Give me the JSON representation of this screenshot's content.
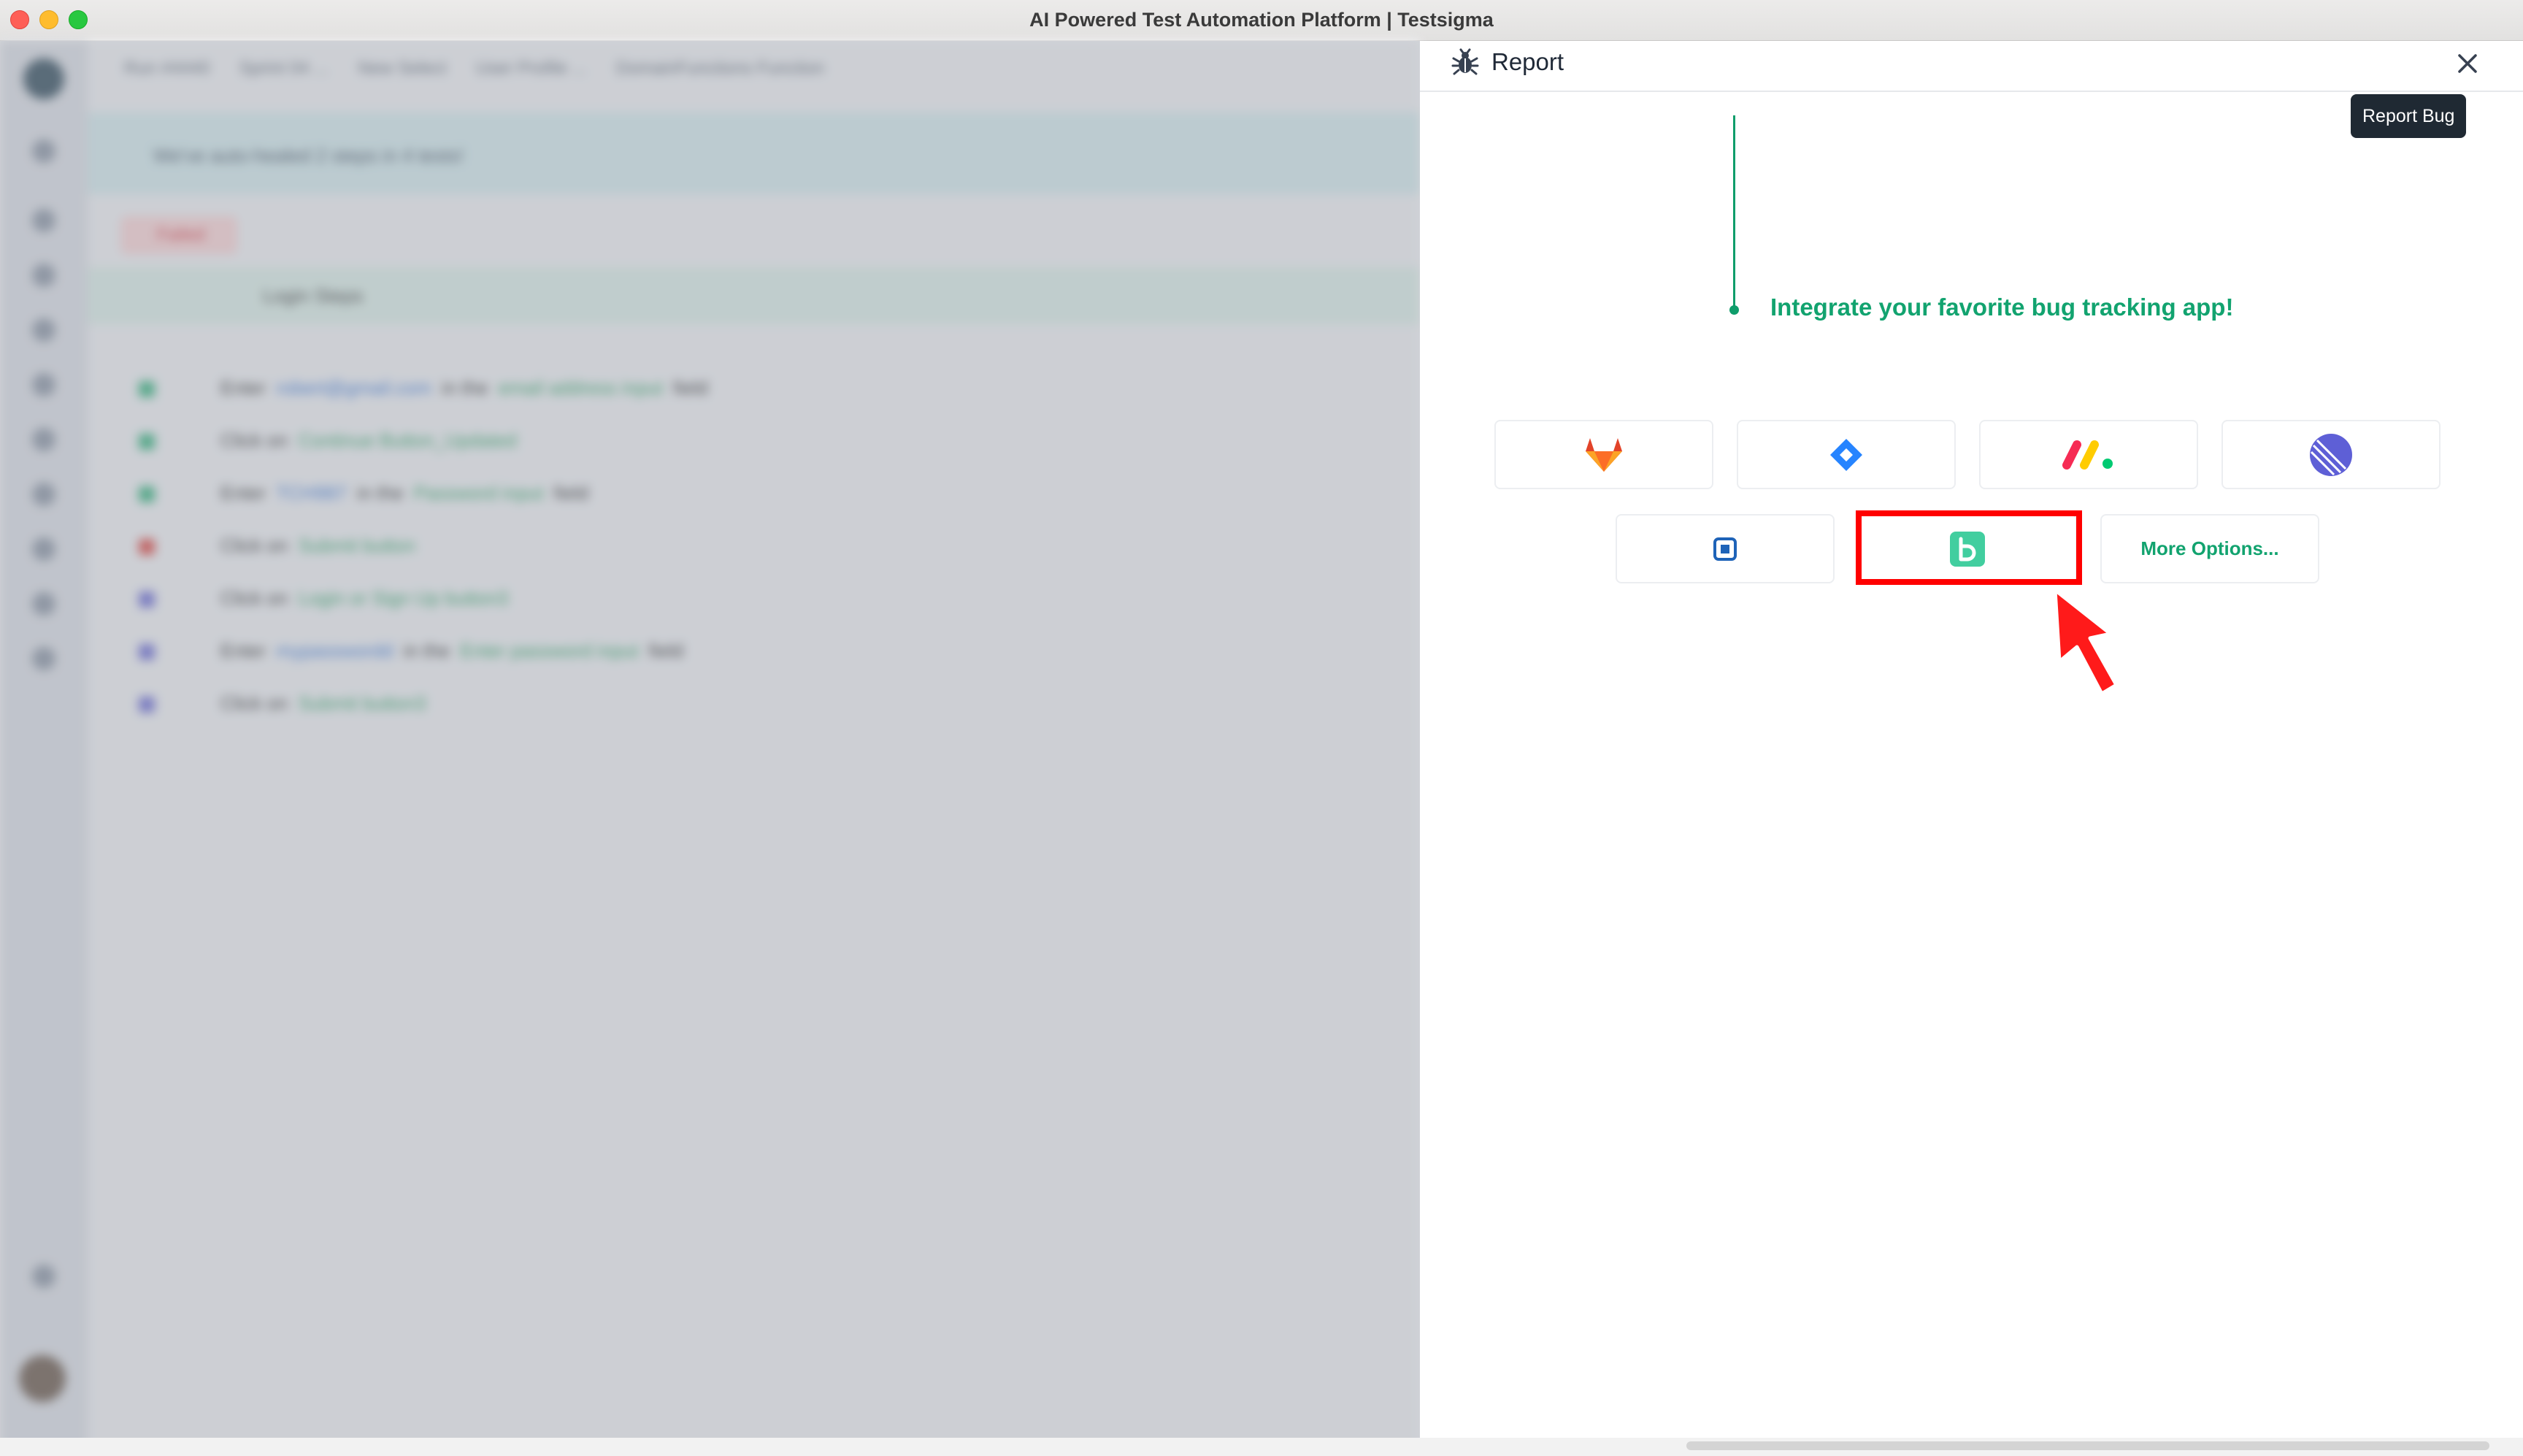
{
  "window": {
    "title": "AI Powered Test Automation Platform | Testsigma"
  },
  "background": {
    "breadcrumbs": [
      "Run #4440",
      "Sprint 04 ...",
      "New Select",
      "User Profile ...",
      "DomainFunctions Function"
    ],
    "banner_text": "We've auto-healed 2 steps in 4 tests!",
    "status_chip": "Failed",
    "group_title": "Login Steps",
    "steps": [
      {
        "status": "passed",
        "parts": [
          [
            "Enter",
            ""
          ],
          [
            "robert@gmail.com",
            "b"
          ],
          [
            "in the",
            ""
          ],
          [
            "email address input",
            "g"
          ],
          [
            "field",
            ""
          ]
        ]
      },
      {
        "status": "passed",
        "parts": [
          [
            "Click on",
            ""
          ],
          [
            "Continue Button_Updated",
            "g"
          ]
        ]
      },
      {
        "status": "passed",
        "parts": [
          [
            "Enter",
            ""
          ],
          [
            "TCH987",
            "b"
          ],
          [
            "in the",
            ""
          ],
          [
            "Password input",
            "g"
          ],
          [
            "field",
            ""
          ]
        ]
      },
      {
        "status": "failed",
        "parts": [
          [
            "Click on",
            ""
          ],
          [
            "Submit button",
            "g"
          ]
        ]
      },
      {
        "status": "skipped",
        "parts": [
          [
            "Click on",
            ""
          ],
          [
            "Login or Sign Up button3",
            "g"
          ]
        ]
      },
      {
        "status": "skipped",
        "parts": [
          [
            "Enter",
            ""
          ],
          [
            "mypasswordd",
            "b"
          ],
          [
            "in the",
            ""
          ],
          [
            "Enter password input",
            "g"
          ],
          [
            "field",
            ""
          ]
        ]
      },
      {
        "status": "skipped",
        "parts": [
          [
            "Click on",
            ""
          ],
          [
            "Submit button3",
            "g"
          ]
        ]
      }
    ]
  },
  "panel": {
    "title": "Report",
    "tooltip": "Report Bug",
    "tagline": "Integrate your favorite bug tracking app!",
    "integrations": [
      {
        "name": "gitlab",
        "icon": "gitlab-icon"
      },
      {
        "name": "jira",
        "icon": "jira-icon"
      },
      {
        "name": "monday",
        "icon": "monday-icon"
      },
      {
        "name": "linear",
        "icon": "linear-icon"
      },
      {
        "name": "azure-boards",
        "icon": "board-icon"
      },
      {
        "name": "backlog",
        "icon": "backlog-icon"
      }
    ],
    "more_label": "More Options...",
    "colors": {
      "accent": "#12a36f",
      "highlight": "#ff0000",
      "tooltip_bg": "#1f2933"
    }
  }
}
